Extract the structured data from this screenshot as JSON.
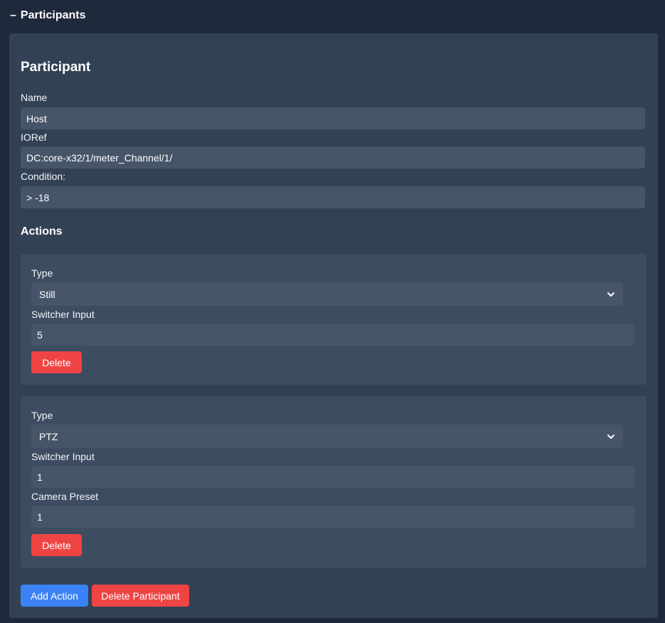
{
  "section": {
    "toggle_symbol": "–",
    "title": "Participants"
  },
  "participant": {
    "title": "Participant",
    "name_label": "Name",
    "name_value": "Host",
    "ioref_label": "IORef",
    "ioref_value": "DC:core-x32/1/meter_Channel/1/",
    "condition_label": "Condition:",
    "condition_value": "> -18",
    "actions_title": "Actions",
    "actions": [
      {
        "type_label": "Type",
        "type_value": "Still",
        "switcher_label": "Switcher Input",
        "switcher_value": "5",
        "delete_label": "Delete"
      },
      {
        "type_label": "Type",
        "type_value": "PTZ",
        "switcher_label": "Switcher Input",
        "switcher_value": "1",
        "preset_label": "Camera Preset",
        "preset_value": "1",
        "delete_label": "Delete"
      }
    ],
    "add_action_label": "Add Action",
    "delete_participant_label": "Delete Participant"
  },
  "colors": {
    "background": "#1e293b",
    "card": "#334155",
    "action_card": "#3e4c61",
    "input": "#475569",
    "danger": "#ef4444",
    "primary": "#3b82f6"
  },
  "icons": {
    "collapse": "minus-icon",
    "select": "chevron-down-icon"
  }
}
